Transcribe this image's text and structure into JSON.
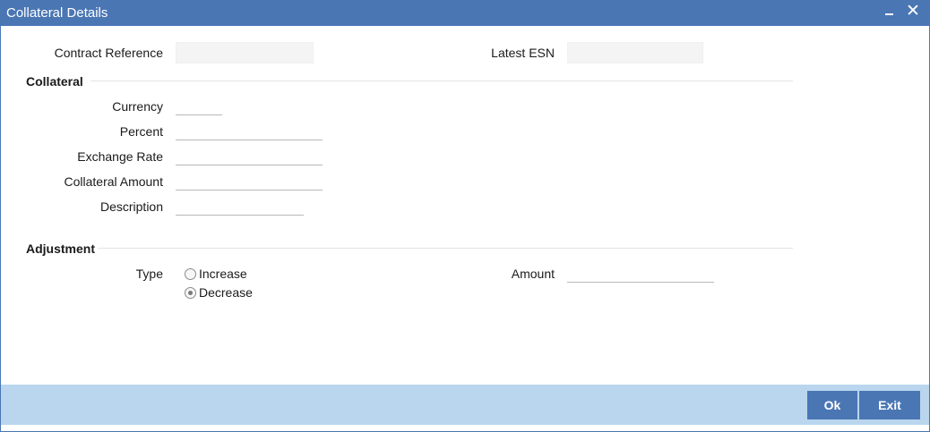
{
  "window": {
    "title": "Collateral Details",
    "close_glyph": "✕"
  },
  "header_fields": {
    "contract_reference": {
      "label": "Contract Reference",
      "value": ""
    },
    "latest_esn": {
      "label": "Latest ESN",
      "value": ""
    }
  },
  "collateral": {
    "section_title": "Collateral",
    "currency": {
      "label": "Currency",
      "value": ""
    },
    "percent": {
      "label": "Percent",
      "value": ""
    },
    "exchange_rate": {
      "label": "Exchange Rate",
      "value": ""
    },
    "collateral_amount": {
      "label": "Collateral Amount",
      "value": ""
    },
    "description": {
      "label": "Description",
      "value": ""
    }
  },
  "adjustment": {
    "section_title": "Adjustment",
    "type_label": "Type",
    "options": [
      {
        "label": "Increase",
        "selected": false
      },
      {
        "label": "Decrease",
        "selected": true
      }
    ],
    "amount": {
      "label": "Amount",
      "value": ""
    }
  },
  "footer": {
    "ok_label": "Ok",
    "exit_label": "Exit"
  },
  "colors": {
    "titlebar": "#4a76b4",
    "footer": "#b9d6ee",
    "button": "#4a76b4"
  },
  "icons": {
    "minimize": "minimize-icon",
    "close": "close-icon"
  }
}
